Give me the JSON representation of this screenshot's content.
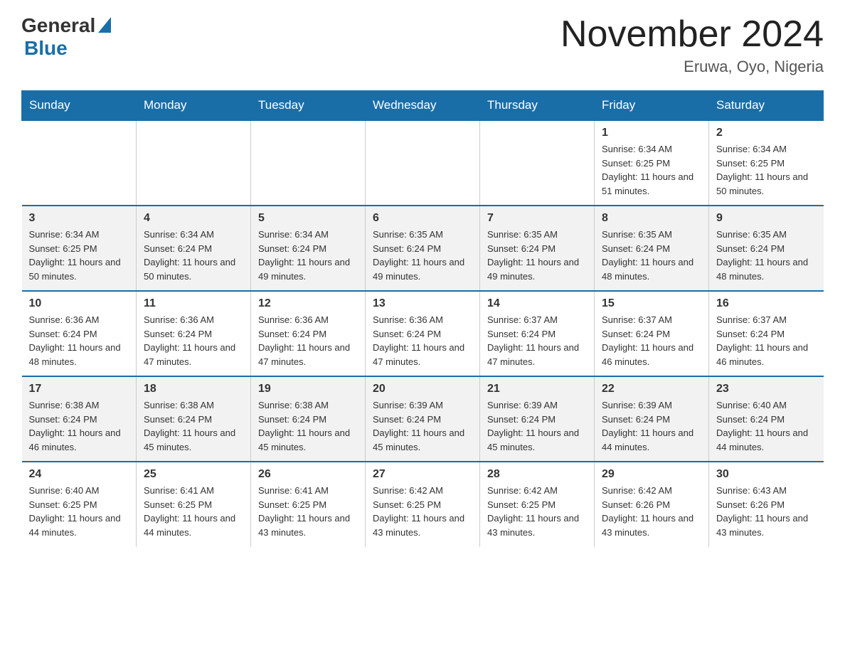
{
  "logo": {
    "text_general": "General",
    "text_blue": "Blue"
  },
  "header": {
    "month_title": "November 2024",
    "location": "Eruwa, Oyo, Nigeria"
  },
  "weekdays": [
    "Sunday",
    "Monday",
    "Tuesday",
    "Wednesday",
    "Thursday",
    "Friday",
    "Saturday"
  ],
  "weeks": [
    [
      {
        "day": "",
        "info": ""
      },
      {
        "day": "",
        "info": ""
      },
      {
        "day": "",
        "info": ""
      },
      {
        "day": "",
        "info": ""
      },
      {
        "day": "",
        "info": ""
      },
      {
        "day": "1",
        "info": "Sunrise: 6:34 AM\nSunset: 6:25 PM\nDaylight: 11 hours and 51 minutes."
      },
      {
        "day": "2",
        "info": "Sunrise: 6:34 AM\nSunset: 6:25 PM\nDaylight: 11 hours and 50 minutes."
      }
    ],
    [
      {
        "day": "3",
        "info": "Sunrise: 6:34 AM\nSunset: 6:25 PM\nDaylight: 11 hours and 50 minutes."
      },
      {
        "day": "4",
        "info": "Sunrise: 6:34 AM\nSunset: 6:24 PM\nDaylight: 11 hours and 50 minutes."
      },
      {
        "day": "5",
        "info": "Sunrise: 6:34 AM\nSunset: 6:24 PM\nDaylight: 11 hours and 49 minutes."
      },
      {
        "day": "6",
        "info": "Sunrise: 6:35 AM\nSunset: 6:24 PM\nDaylight: 11 hours and 49 minutes."
      },
      {
        "day": "7",
        "info": "Sunrise: 6:35 AM\nSunset: 6:24 PM\nDaylight: 11 hours and 49 minutes."
      },
      {
        "day": "8",
        "info": "Sunrise: 6:35 AM\nSunset: 6:24 PM\nDaylight: 11 hours and 48 minutes."
      },
      {
        "day": "9",
        "info": "Sunrise: 6:35 AM\nSunset: 6:24 PM\nDaylight: 11 hours and 48 minutes."
      }
    ],
    [
      {
        "day": "10",
        "info": "Sunrise: 6:36 AM\nSunset: 6:24 PM\nDaylight: 11 hours and 48 minutes."
      },
      {
        "day": "11",
        "info": "Sunrise: 6:36 AM\nSunset: 6:24 PM\nDaylight: 11 hours and 47 minutes."
      },
      {
        "day": "12",
        "info": "Sunrise: 6:36 AM\nSunset: 6:24 PM\nDaylight: 11 hours and 47 minutes."
      },
      {
        "day": "13",
        "info": "Sunrise: 6:36 AM\nSunset: 6:24 PM\nDaylight: 11 hours and 47 minutes."
      },
      {
        "day": "14",
        "info": "Sunrise: 6:37 AM\nSunset: 6:24 PM\nDaylight: 11 hours and 47 minutes."
      },
      {
        "day": "15",
        "info": "Sunrise: 6:37 AM\nSunset: 6:24 PM\nDaylight: 11 hours and 46 minutes."
      },
      {
        "day": "16",
        "info": "Sunrise: 6:37 AM\nSunset: 6:24 PM\nDaylight: 11 hours and 46 minutes."
      }
    ],
    [
      {
        "day": "17",
        "info": "Sunrise: 6:38 AM\nSunset: 6:24 PM\nDaylight: 11 hours and 46 minutes."
      },
      {
        "day": "18",
        "info": "Sunrise: 6:38 AM\nSunset: 6:24 PM\nDaylight: 11 hours and 45 minutes."
      },
      {
        "day": "19",
        "info": "Sunrise: 6:38 AM\nSunset: 6:24 PM\nDaylight: 11 hours and 45 minutes."
      },
      {
        "day": "20",
        "info": "Sunrise: 6:39 AM\nSunset: 6:24 PM\nDaylight: 11 hours and 45 minutes."
      },
      {
        "day": "21",
        "info": "Sunrise: 6:39 AM\nSunset: 6:24 PM\nDaylight: 11 hours and 45 minutes."
      },
      {
        "day": "22",
        "info": "Sunrise: 6:39 AM\nSunset: 6:24 PM\nDaylight: 11 hours and 44 minutes."
      },
      {
        "day": "23",
        "info": "Sunrise: 6:40 AM\nSunset: 6:24 PM\nDaylight: 11 hours and 44 minutes."
      }
    ],
    [
      {
        "day": "24",
        "info": "Sunrise: 6:40 AM\nSunset: 6:25 PM\nDaylight: 11 hours and 44 minutes."
      },
      {
        "day": "25",
        "info": "Sunrise: 6:41 AM\nSunset: 6:25 PM\nDaylight: 11 hours and 44 minutes."
      },
      {
        "day": "26",
        "info": "Sunrise: 6:41 AM\nSunset: 6:25 PM\nDaylight: 11 hours and 43 minutes."
      },
      {
        "day": "27",
        "info": "Sunrise: 6:42 AM\nSunset: 6:25 PM\nDaylight: 11 hours and 43 minutes."
      },
      {
        "day": "28",
        "info": "Sunrise: 6:42 AM\nSunset: 6:25 PM\nDaylight: 11 hours and 43 minutes."
      },
      {
        "day": "29",
        "info": "Sunrise: 6:42 AM\nSunset: 6:26 PM\nDaylight: 11 hours and 43 minutes."
      },
      {
        "day": "30",
        "info": "Sunrise: 6:43 AM\nSunset: 6:26 PM\nDaylight: 11 hours and 43 minutes."
      }
    ]
  ]
}
